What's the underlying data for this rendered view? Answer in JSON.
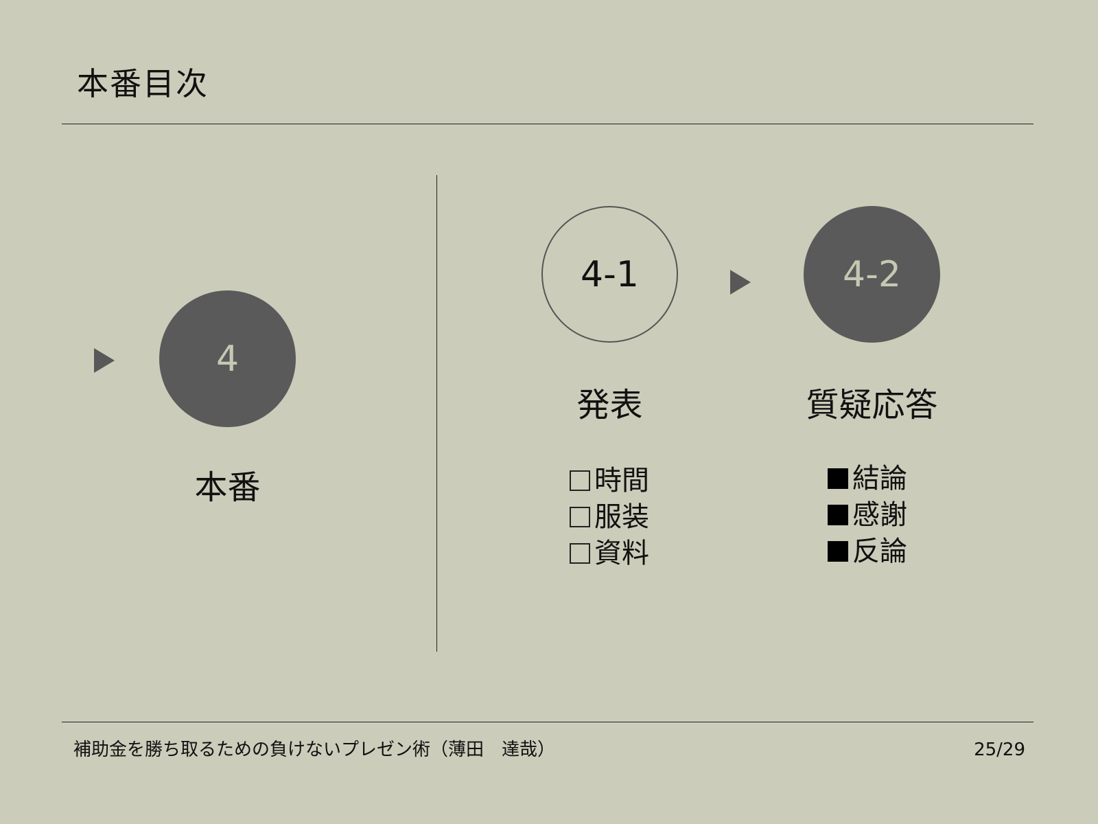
{
  "slide": {
    "title": "本番目次",
    "footer": "補助金を勝ち取るための負けないプレゼン術（薄田　達哉）",
    "page_number": "25/29"
  },
  "left": {
    "number": "4",
    "label": "本番"
  },
  "steps": [
    {
      "number": "4-1",
      "label": "発表",
      "style": "outline",
      "checklist": [
        {
          "mark": "☐",
          "text": "時間"
        },
        {
          "mark": "☐",
          "text": "服装"
        },
        {
          "mark": "☐",
          "text": "資料"
        }
      ]
    },
    {
      "number": "4-2",
      "label": "質疑応答",
      "style": "filled",
      "checklist": [
        {
          "mark": "■",
          "text": "結論"
        },
        {
          "mark": "■",
          "text": "感謝"
        },
        {
          "mark": "■",
          "text": "反論"
        }
      ]
    }
  ],
  "colors": {
    "background": "#cbccba",
    "circle_fill": "#5a5a5a",
    "arrow": "#585858"
  }
}
